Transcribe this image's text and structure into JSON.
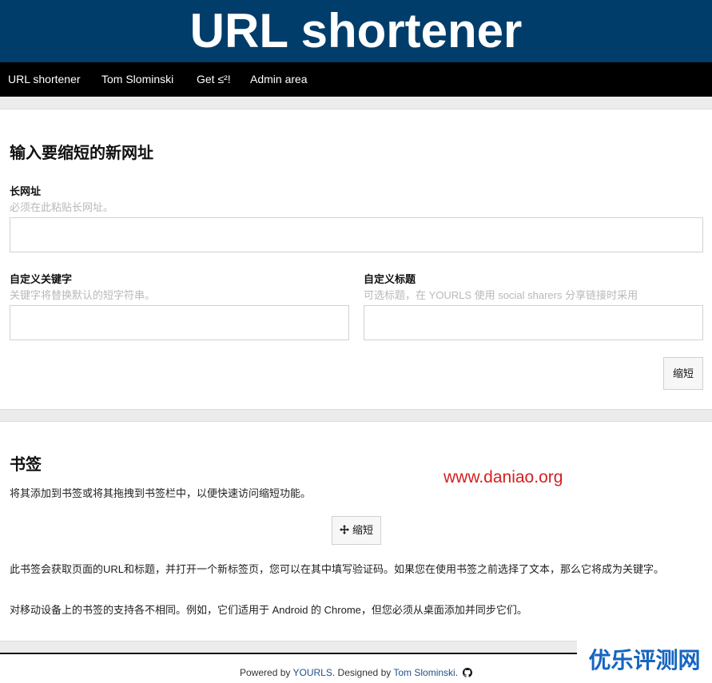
{
  "header": {
    "title": "URL shortener"
  },
  "nav": {
    "items": [
      {
        "label": "URL shortener"
      },
      {
        "label": "Tom Slominski"
      },
      {
        "label": "Get ≤²!"
      },
      {
        "label": "Admin area"
      }
    ]
  },
  "shorten_form": {
    "title": "输入要缩短的新网址",
    "long_url": {
      "label": "长网址",
      "hint": "必须在此粘贴长网址。",
      "value": ""
    },
    "keyword": {
      "label": "自定义关键字",
      "hint": "关键字将替换默认的短字符串。",
      "value": ""
    },
    "custom_title": {
      "label": "自定义标题",
      "hint": "可选标题，在 YOURLS 使用 social sharers 分享链接时采用",
      "value": ""
    },
    "submit_label": "缩短"
  },
  "bookmarklet": {
    "title": "书签",
    "intro": "将其添加到书签或将其拖拽到书签栏中，以便快速访问缩短功能。",
    "button_label": "缩短",
    "desc1": "此书签会获取页面的URL和标题，并打开一个新标签页，您可以在其中填写验证码。如果您在使用书签之前选择了文本，那么它将成为关键字。",
    "desc2": "对移动设备上的书签的支持各不相同。例如，它们适用于 Android 的 Chrome，但您必须从桌面添加并同步它们。"
  },
  "watermark": {
    "text": "www.daniao.org"
  },
  "footer": {
    "powered": "Powered by ",
    "yourls": "YOURLS",
    "designed": ". Designed by ",
    "author": "Tom Slominski",
    "end": "."
  },
  "corner_logo": {
    "text": "优乐评测网"
  },
  "icons": {
    "github": "github-icon",
    "move": "move-arrows-icon"
  },
  "colors": {
    "header_bg": "#003d6b",
    "nav_bg": "#000000",
    "link": "#1f4f8a",
    "watermark": "#d42020",
    "corner_logo": "#1565c0"
  }
}
